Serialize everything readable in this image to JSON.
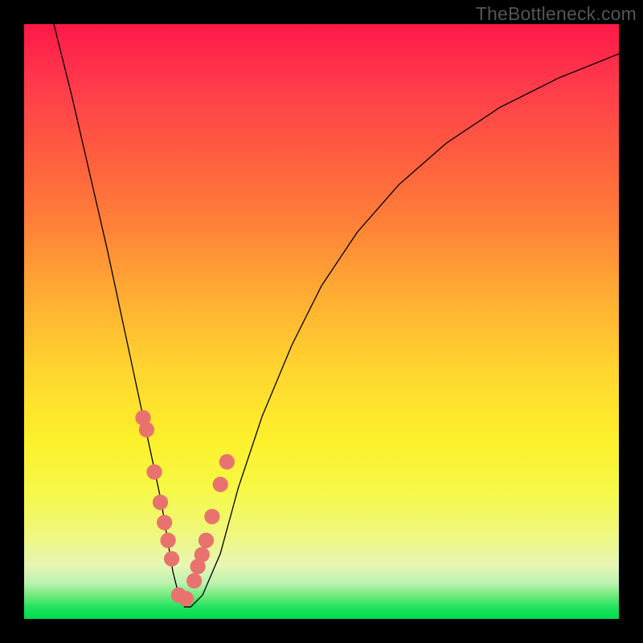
{
  "watermark": "TheBottleneck.com",
  "chart_data": {
    "type": "line",
    "title": "",
    "xlabel": "",
    "ylabel": "",
    "xlim": [
      0,
      100
    ],
    "ylim": [
      0,
      100
    ],
    "grid": false,
    "legend": false,
    "background_gradient": {
      "top": "#ff1848",
      "mid_upper": "#ff8238",
      "mid_lower": "#fcf02b",
      "bottom": "#00dc4e"
    },
    "series": [
      {
        "name": "curve",
        "color": "#000000",
        "x": [
          5,
          8,
          11,
          14,
          17,
          20,
          23,
          25,
          26,
          27,
          28,
          30,
          33,
          36,
          40,
          45,
          50,
          56,
          63,
          71,
          80,
          90,
          100
        ],
        "y": [
          100,
          88,
          75,
          62,
          48,
          34,
          20,
          8,
          4,
          2,
          2,
          4,
          11,
          22,
          34,
          46,
          56,
          65,
          73,
          80,
          86,
          91,
          95
        ]
      },
      {
        "name": "dots",
        "color": "#e8736e",
        "x": [
          20.0,
          20.6,
          21.9,
          22.9,
          23.6,
          24.2,
          24.8,
          26.0,
          27.2,
          28.6,
          29.2,
          29.9,
          30.6,
          31.6,
          33.0,
          34.1
        ],
        "y": [
          33.8,
          31.8,
          24.7,
          19.6,
          16.2,
          13.2,
          10.1,
          4.0,
          3.4,
          6.4,
          8.8,
          10.8,
          13.2,
          17.2,
          22.6,
          26.4
        ]
      }
    ]
  }
}
